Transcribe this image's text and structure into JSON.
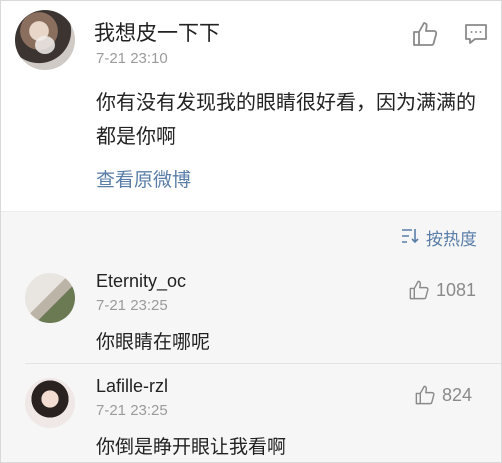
{
  "post": {
    "username": "我想皮一下下",
    "time": "7-21 23:10",
    "text": "你有没有发现我的眼睛很好看，因为满满的都是你啊",
    "view_original": "查看原微博",
    "icons": {
      "like": "thumbs-up-icon",
      "comment": "comment-icon"
    }
  },
  "sort": {
    "label": "按热度",
    "icon": "sort-icon"
  },
  "comments": [
    {
      "username": "Eternity_oc",
      "time": "7-21 23:25",
      "text": "你眼睛在哪呢",
      "likes": "1081"
    },
    {
      "username": "Lafille-rzl",
      "time": "7-21 23:25",
      "text": "你倒是睁开眼让我看啊",
      "likes": "824"
    }
  ],
  "colors": {
    "link": "#5a7ea8",
    "muted": "#9b9b9b",
    "panel": "#f6f6f6"
  }
}
